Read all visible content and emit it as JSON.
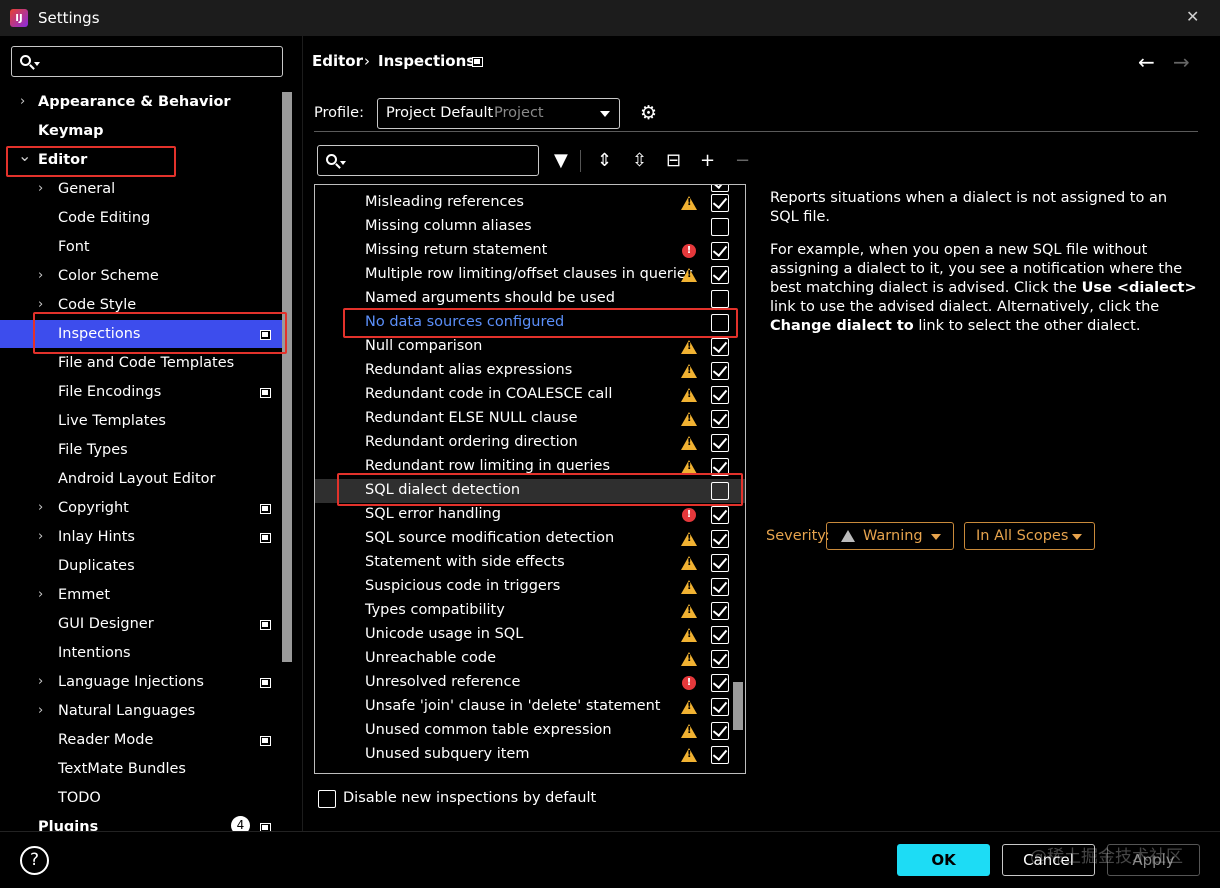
{
  "window": {
    "title": "Settings",
    "close_glyph": "✕"
  },
  "sidebar": {
    "search_placeholder": "",
    "items": [
      {
        "label": "Appearance & Behavior",
        "bold": true
      },
      {
        "label": "Keymap",
        "bold": true
      },
      {
        "label": "Editor",
        "bold": true
      },
      {
        "label": "General"
      },
      {
        "label": "Code Editing"
      },
      {
        "label": "Font"
      },
      {
        "label": "Color Scheme"
      },
      {
        "label": "Code Style"
      },
      {
        "label": "Inspections",
        "selected": true
      },
      {
        "label": "File and Code Templates"
      },
      {
        "label": "File Encodings"
      },
      {
        "label": "Live Templates"
      },
      {
        "label": "File Types"
      },
      {
        "label": "Android Layout Editor"
      },
      {
        "label": "Copyright"
      },
      {
        "label": "Inlay Hints"
      },
      {
        "label": "Duplicates"
      },
      {
        "label": "Emmet"
      },
      {
        "label": "GUI Designer"
      },
      {
        "label": "Intentions"
      },
      {
        "label": "Language Injections"
      },
      {
        "label": "Natural Languages"
      },
      {
        "label": "Reader Mode"
      },
      {
        "label": "TextMate Bundles"
      },
      {
        "label": "TODO"
      },
      {
        "label": "Plugins",
        "bold": true,
        "badge": "4"
      }
    ]
  },
  "breadcrumb": {
    "parent": "Editor",
    "separator": "›",
    "current": "Inspections"
  },
  "profile": {
    "label": "Profile:",
    "value": "Project Default",
    "scope": "Project"
  },
  "inspections": [
    {
      "label": "Misleading references",
      "level": "warning",
      "checked": true
    },
    {
      "label": "Missing column aliases",
      "level": "none",
      "checked": false
    },
    {
      "label": "Missing return statement",
      "level": "error",
      "checked": true
    },
    {
      "label": "Multiple row limiting/offset clauses in queries",
      "level": "warning",
      "checked": true
    },
    {
      "label": "Named arguments should be used",
      "level": "none",
      "checked": false
    },
    {
      "label": "No data sources configured",
      "level": "none",
      "checked": false,
      "link": true
    },
    {
      "label": "Null comparison",
      "level": "warning",
      "checked": true
    },
    {
      "label": "Redundant alias expressions",
      "level": "warning",
      "checked": true
    },
    {
      "label": "Redundant code in COALESCE call",
      "level": "warning",
      "checked": true
    },
    {
      "label": "Redundant ELSE NULL clause",
      "level": "warning",
      "checked": true
    },
    {
      "label": "Redundant ordering direction",
      "level": "warning",
      "checked": true
    },
    {
      "label": "Redundant row limiting in queries",
      "level": "warning",
      "checked": true
    },
    {
      "label": "SQL dialect detection",
      "level": "none",
      "checked": false,
      "highlighted": true
    },
    {
      "label": "SQL error handling",
      "level": "error",
      "checked": true
    },
    {
      "label": "SQL source modification detection",
      "level": "warning",
      "checked": true
    },
    {
      "label": "Statement with side effects",
      "level": "warning",
      "checked": true
    },
    {
      "label": "Suspicious code in triggers",
      "level": "warning",
      "checked": true
    },
    {
      "label": "Types compatibility",
      "level": "warning",
      "checked": true
    },
    {
      "label": "Unicode usage in SQL",
      "level": "warning",
      "checked": true
    },
    {
      "label": "Unreachable code",
      "level": "warning",
      "checked": true
    },
    {
      "label": "Unresolved reference",
      "level": "error",
      "checked": true
    },
    {
      "label": "Unsafe 'join' clause in 'delete' statement",
      "level": "warning",
      "checked": true
    },
    {
      "label": "Unused common table expression",
      "level": "warning",
      "checked": true
    },
    {
      "label": "Unused subquery item",
      "level": "warning",
      "checked": true
    }
  ],
  "description": {
    "p1": "Reports situations when a dialect is not assigned to an SQL file.",
    "p2_a": "For example, when you open a new SQL file without assigning a dialect to it, you see a notification where the best matching dialect is advised. Click the ",
    "p2_b": "Use <dialect>",
    "p2_c": " link to use the advised dialect. Alternatively, click the ",
    "p2_d": "Change dialect to",
    "p2_e": " link to select the other dialect."
  },
  "severity": {
    "label": "Severity:",
    "value": "Warning",
    "scope": "In All Scopes"
  },
  "options": {
    "disable_new_label": "Disable new inspections by default",
    "disable_new_checked": false
  },
  "footer": {
    "ok": "OK",
    "cancel": "Cancel",
    "apply": "Apply",
    "help": "?",
    "watermark": "@稀土掘金技术社区"
  },
  "colors": {
    "selection": "#3d4ded",
    "link": "#5b8ff9",
    "warning": "#f1b232",
    "error": "#e5383b",
    "ok_button": "#1ddcf5",
    "annotation": "#e3322b"
  }
}
